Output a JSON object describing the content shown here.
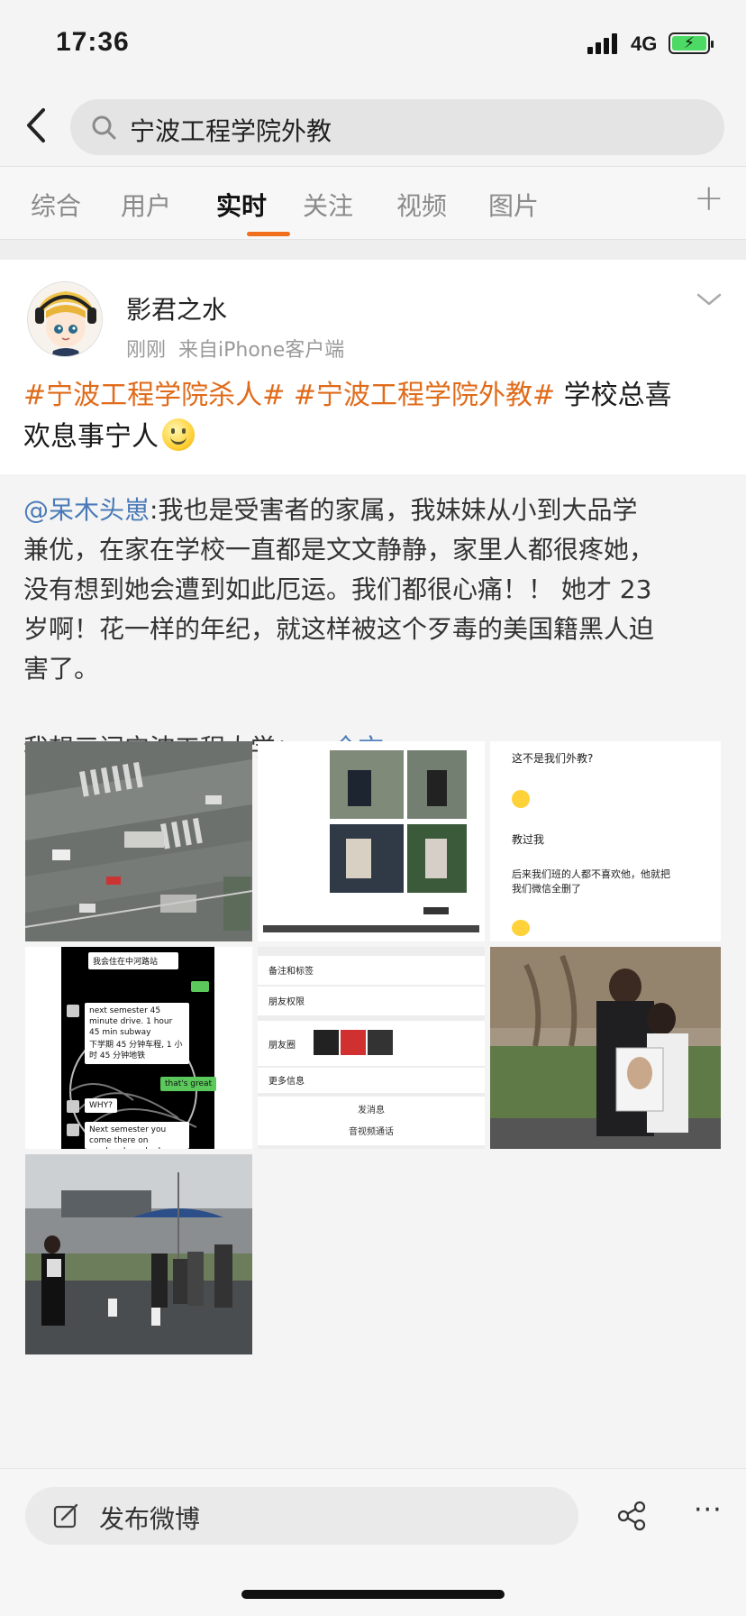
{
  "status": {
    "time": "17:36",
    "network": "4G"
  },
  "search": {
    "query": "宁波工程学院外教"
  },
  "tabs": [
    {
      "label": "综合"
    },
    {
      "label": "用户"
    },
    {
      "label": "实时"
    },
    {
      "label": "关注"
    },
    {
      "label": "视频"
    },
    {
      "label": "图片"
    }
  ],
  "post": {
    "author": "影君之水",
    "time": "刚刚",
    "source": "来自iPhone客户端",
    "hashtag_1": "#宁波工程学院杀人#",
    "hashtag_2": "#宁波工程学院外教#",
    "text_a": "学校总喜",
    "text_b": "欢息事宁人",
    "repost": {
      "mention": "@呆木头崽",
      "line_1": ":我也是受害者的家属，我妹妹从小到大品学",
      "line_2": "兼优，在家在学校一直都是文文静静，家里人都很疼她，",
      "line_3": "没有想到她会遭到如此厄运。我们都很心痛！！ 她才 23",
      "line_4": "岁啊！花一样的年纪，就这样被这个歹毒的美国籍黑人迫",
      "line_5": "害了。",
      "line_6": "我想三问宁波工程大学：... ",
      "more": "全文"
    }
  },
  "images": {
    "chat1_q": "这不是我们外教?",
    "chat1_a": "教过我",
    "chat1_b1": "后来我们班的人都不喜欢他，他就把",
    "chat1_b2": "我们微信全删了",
    "chat2_m1": "我会住在中河路站",
    "chat2_m2": "next semester 45 minute drive. 1 hour 45 min subway",
    "chat2_m3": "下学期 45 分钟车程, 1 小时 45 分钟地铁",
    "chat2_m4": "that's great",
    "chat2_m5": "WHY?",
    "chat2_m6": "Next semester you come there on weekends and relax and",
    "profile_r1": "备注和标签",
    "profile_r2": "朋友权限",
    "profile_r3": "朋友圈",
    "profile_r4": "更多信息",
    "profile_b1": "发消息",
    "profile_b2": "音视频通话"
  },
  "bottom": {
    "compose_label": "发布微博"
  }
}
